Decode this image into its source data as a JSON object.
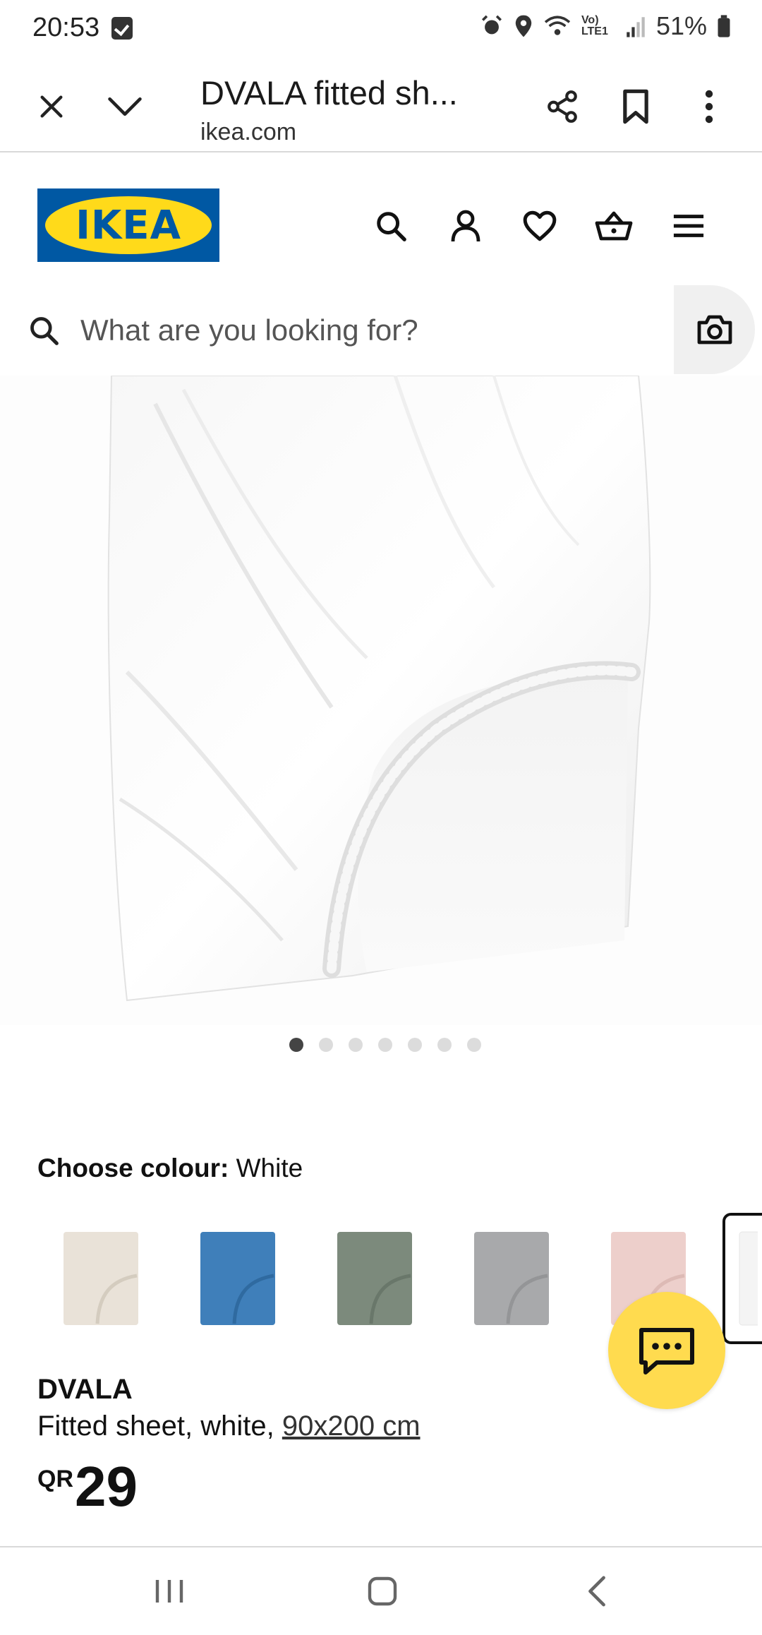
{
  "status_bar": {
    "time": "20:53",
    "battery": "51%",
    "network": "Vo) LTE1"
  },
  "tab": {
    "title": "DVALA fitted sh...",
    "url": "ikea.com"
  },
  "site": {
    "logo_text": "IKEA",
    "brand_blue": "#0058a3",
    "brand_yellow": "#ffda1a"
  },
  "search": {
    "placeholder": "What are you looking for?"
  },
  "gallery": {
    "total_images": 7,
    "active_index": 1
  },
  "colour": {
    "label": "Choose colour:",
    "selected": "White",
    "swatches": [
      {
        "name": "beige",
        "color": "#e9e2d8"
      },
      {
        "name": "blue",
        "color": "#3f7fba"
      },
      {
        "name": "grey-green",
        "color": "#7c8a7c"
      },
      {
        "name": "light grey",
        "color": "#a8a9ab"
      },
      {
        "name": "pink",
        "color": "#edcfcb"
      },
      {
        "name": "white",
        "color": "#f4f4f4"
      }
    ]
  },
  "product": {
    "name": "DVALA",
    "desc_prefix": "Fitted sheet, white, ",
    "size": "90x200 cm",
    "currency": "QR",
    "price": "29"
  },
  "icons": {
    "close": "close-icon",
    "minimize": "chevron-down-icon",
    "share": "share-icon",
    "bookmark": "bookmark-icon",
    "menu": "more-vert-icon",
    "search": "search-icon",
    "account": "person-icon",
    "wishlist": "heart-icon",
    "basket": "basket-icon",
    "hamburger": "hamburger-menu-icon",
    "camera": "camera-icon",
    "chat": "chat-icon"
  }
}
